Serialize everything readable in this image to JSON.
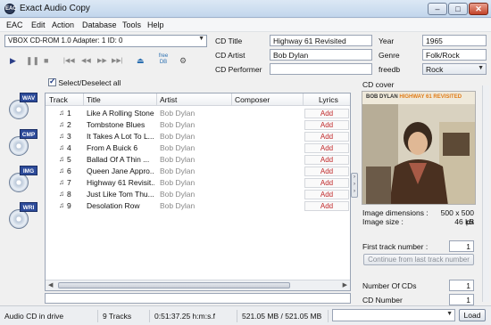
{
  "window": {
    "title": "Exact Audio Copy",
    "app_icon_text": "EAC"
  },
  "menu": [
    "EAC",
    "Edit",
    "Action",
    "Database",
    "Tools",
    "Help"
  ],
  "drive": {
    "selected": "VBOX    CD-ROM 1.0   Adapter: 1  ID: 0"
  },
  "toolbar": {
    "play": "▶",
    "pause": "❚❚",
    "stop": "■",
    "first": "|◀◀",
    "prev": "◀◀",
    "next": "▶▶",
    "last": "▶▶|",
    "eject": "⏏",
    "freedb_label": "free DB"
  },
  "metadata": {
    "cd_title_label": "CD Title",
    "cd_title": "Highway 61 Revisited",
    "cd_artist_label": "CD Artist",
    "cd_artist": "Bob Dylan",
    "cd_performer_label": "CD Performer",
    "cd_performer": "",
    "year_label": "Year",
    "year": "1965",
    "genre_label": "Genre",
    "genre": "Folk/Rock",
    "freedb_label": "freedb",
    "freedb": "Rock"
  },
  "sidebar": [
    {
      "tag": "WAV"
    },
    {
      "tag": "CMP"
    },
    {
      "tag": "IMG"
    },
    {
      "tag": "WRI"
    }
  ],
  "select_all_label": "Select/Deselect all",
  "table": {
    "headers": {
      "track": "Track",
      "title": "Title",
      "artist": "Artist",
      "composer": "Composer",
      "lyrics": "Lyrics"
    },
    "rows": [
      {
        "num": "1",
        "title": "Like A Rolling Stone",
        "artist": "Bob Dylan",
        "lyrics": "Add"
      },
      {
        "num": "2",
        "title": "Tombstone Blues",
        "artist": "Bob Dylan",
        "lyrics": "Add"
      },
      {
        "num": "3",
        "title": "It Takes A Lot To L...",
        "artist": "Bob Dylan",
        "lyrics": "Add"
      },
      {
        "num": "4",
        "title": "From A Buick 6",
        "artist": "Bob Dylan",
        "lyrics": "Add"
      },
      {
        "num": "5",
        "title": "Ballad Of A Thin ...",
        "artist": "Bob Dylan",
        "lyrics": "Add"
      },
      {
        "num": "6",
        "title": "Queen Jane Appro...",
        "artist": "Bob Dylan",
        "lyrics": "Add"
      },
      {
        "num": "7",
        "title": "Highway 61 Revisit...",
        "artist": "Bob Dylan",
        "lyrics": "Add"
      },
      {
        "num": "8",
        "title": "Just Like Tom Thu...",
        "artist": "Bob Dylan",
        "lyrics": "Add"
      },
      {
        "num": "9",
        "title": "Desolation Row",
        "artist": "Bob Dylan",
        "lyrics": "Add"
      }
    ]
  },
  "cover": {
    "label": "CD cover",
    "artist_text": "BOB DYLAN",
    "album_text": "HIGHWAY 61 REVISITED",
    "dimensions_label": "Image dimensions :",
    "dimensions": "500 x 500 px",
    "size_label": "Image size :",
    "size": "46 kB"
  },
  "right_panel": {
    "first_track_label": "First track number :",
    "first_track": "1",
    "continue_button": "Continue from last track number",
    "num_cds_label": "Number Of CDs",
    "num_cds": "1",
    "cd_number_label": "CD Number",
    "cd_number": "1"
  },
  "status": {
    "drive": "Audio CD in drive",
    "tracks": "9 Tracks",
    "time": "0:51:37.25 h:m:s.f",
    "size": "521.05 MB / 521.05 MB",
    "load_button": "Load"
  }
}
